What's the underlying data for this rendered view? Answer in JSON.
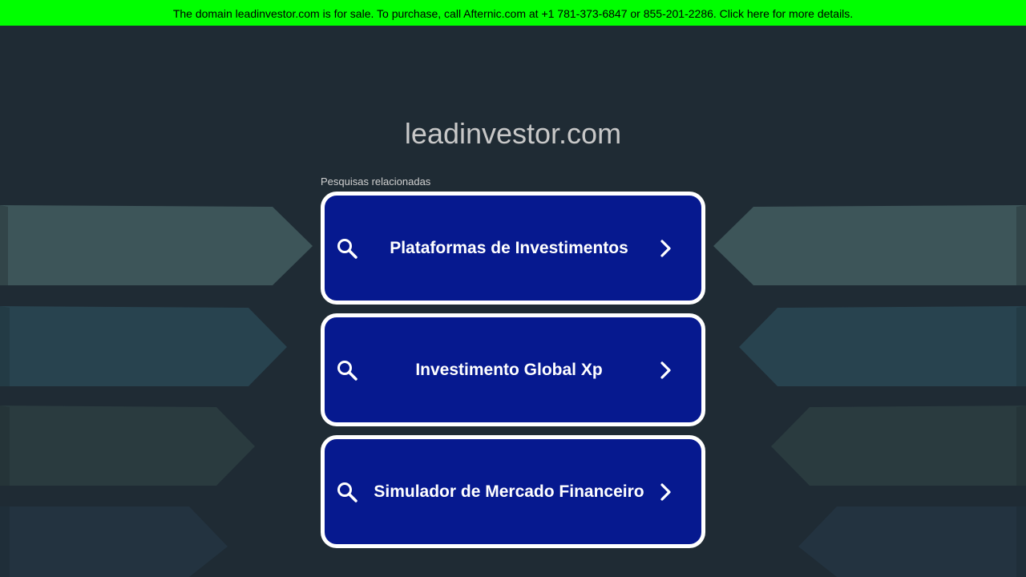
{
  "banner": {
    "text": "The domain leadinvestor.com is for sale. To purchase, call Afternic.com at +1 781-373-6847 or 855-201-2286. Click here for more details."
  },
  "domain": "leadinvestor.com",
  "related_label": "Pesquisas relacionadas",
  "results": [
    {
      "label": "Plataformas de Investimentos"
    },
    {
      "label": "Investimento Global Xp"
    },
    {
      "label": "Simulador de Mercado Financeiro"
    }
  ],
  "colors": {
    "banner_bg": "#00ff00",
    "page_bg": "#1f2b34",
    "result_bg": "#06198f",
    "result_border": "#ffffff"
  }
}
